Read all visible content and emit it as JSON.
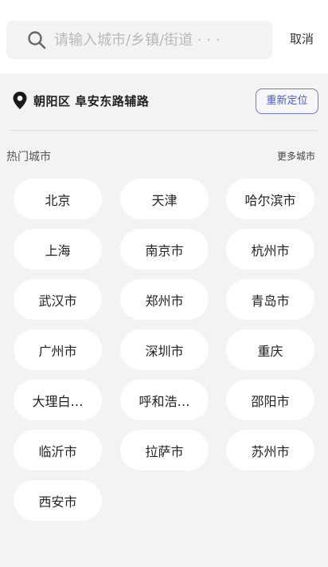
{
  "search": {
    "placeholder": "请输入城市/乡镇/街道 · · ·",
    "cancel_label": "取消"
  },
  "location": {
    "current": "朝阳区 阜安东路辅路",
    "relocate_label": "重新定位"
  },
  "hot": {
    "title": "热门城市",
    "more_label": "更多城市",
    "cities": [
      "北京",
      "天津",
      "哈尔滨市",
      "上海",
      "南京市",
      "杭州市",
      "武汉市",
      "郑州市",
      "青岛市",
      "广州市",
      "深圳市",
      "重庆",
      "大理白…",
      "呼和浩…",
      "邵阳市",
      "临沂市",
      "拉萨市",
      "苏州市",
      "西安市"
    ]
  },
  "colors": {
    "accent": "#6b79d8",
    "background": "#f3f3f4",
    "chip": "#ffffff"
  },
  "icons": {
    "search": "search-icon",
    "location": "map-pin-icon"
  }
}
